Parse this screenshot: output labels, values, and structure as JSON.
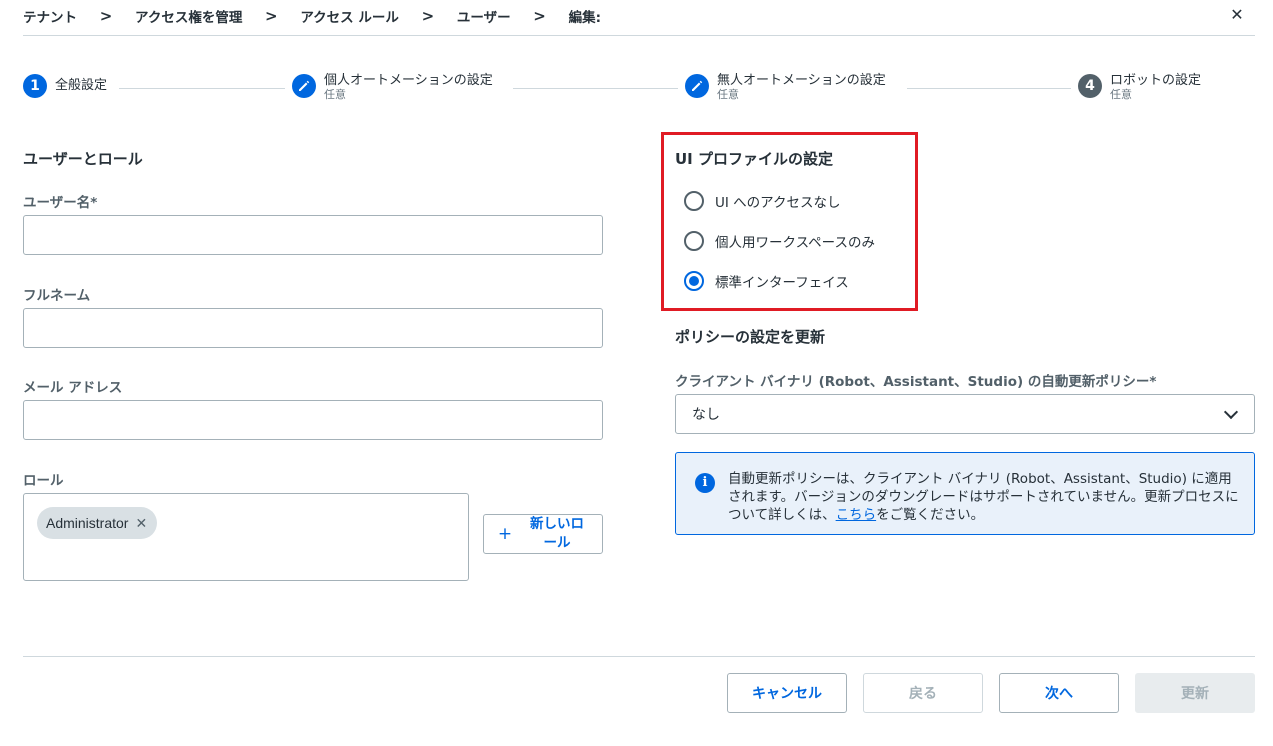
{
  "breadcrumb": {
    "items": [
      "テナント",
      "アクセス権を管理",
      "アクセス ルール",
      "ユーザー",
      "編集:"
    ],
    "separator": ">"
  },
  "close_icon": "✕",
  "stepper": {
    "steps": [
      {
        "number": "1",
        "label": "全般設定",
        "sub": "",
        "state": "active"
      },
      {
        "number": "",
        "label": "個人オートメーションの設定",
        "sub": "任意",
        "state": "edit"
      },
      {
        "number": "",
        "label": "無人オートメーションの設定",
        "sub": "任意",
        "state": "edit"
      },
      {
        "number": "4",
        "label": "ロボットの設定",
        "sub": "任意",
        "state": "pending"
      }
    ]
  },
  "user_roles": {
    "title": "ユーザーとロール",
    "username_label": "ユーザー名*",
    "username_value": "",
    "fullname_label": "フルネーム",
    "fullname_value": "",
    "email_label": "メール アドレス",
    "email_value": "",
    "roles_label": "ロール",
    "roles": [
      "Administrator"
    ],
    "chip_remove_icon": "✕",
    "new_role_icon": "+",
    "new_role_button": "新しいロール"
  },
  "ui_profile": {
    "title": "UI プロファイルの設定",
    "options": [
      "UI へのアクセスなし",
      "個人用ワークスペースのみ",
      "標準インターフェイス"
    ],
    "selected_index": 2
  },
  "update_policy": {
    "title": "ポリシーの設定を更新",
    "client_label": "クライアント バイナリ (Robot、Assistant、Studio) の自動更新ポリシー*",
    "selected": "なし",
    "info_icon": "i",
    "info_before": "自動更新ポリシーは、クライアント バイナリ (Robot、Assistant、Studio) に適用されます。バージョンのダウングレードはサポートされていません。更新プロセスについて詳しくは、",
    "info_link": "こちら",
    "info_after": "をご覧ください。"
  },
  "footer": {
    "cancel": "キャンセル",
    "back": "戻る",
    "next": "次へ",
    "update": "更新"
  },
  "colors": {
    "accent": "#0067df",
    "highlight_box": "#e01b24",
    "info_bg": "#e9f1fa",
    "text": "#273139"
  }
}
